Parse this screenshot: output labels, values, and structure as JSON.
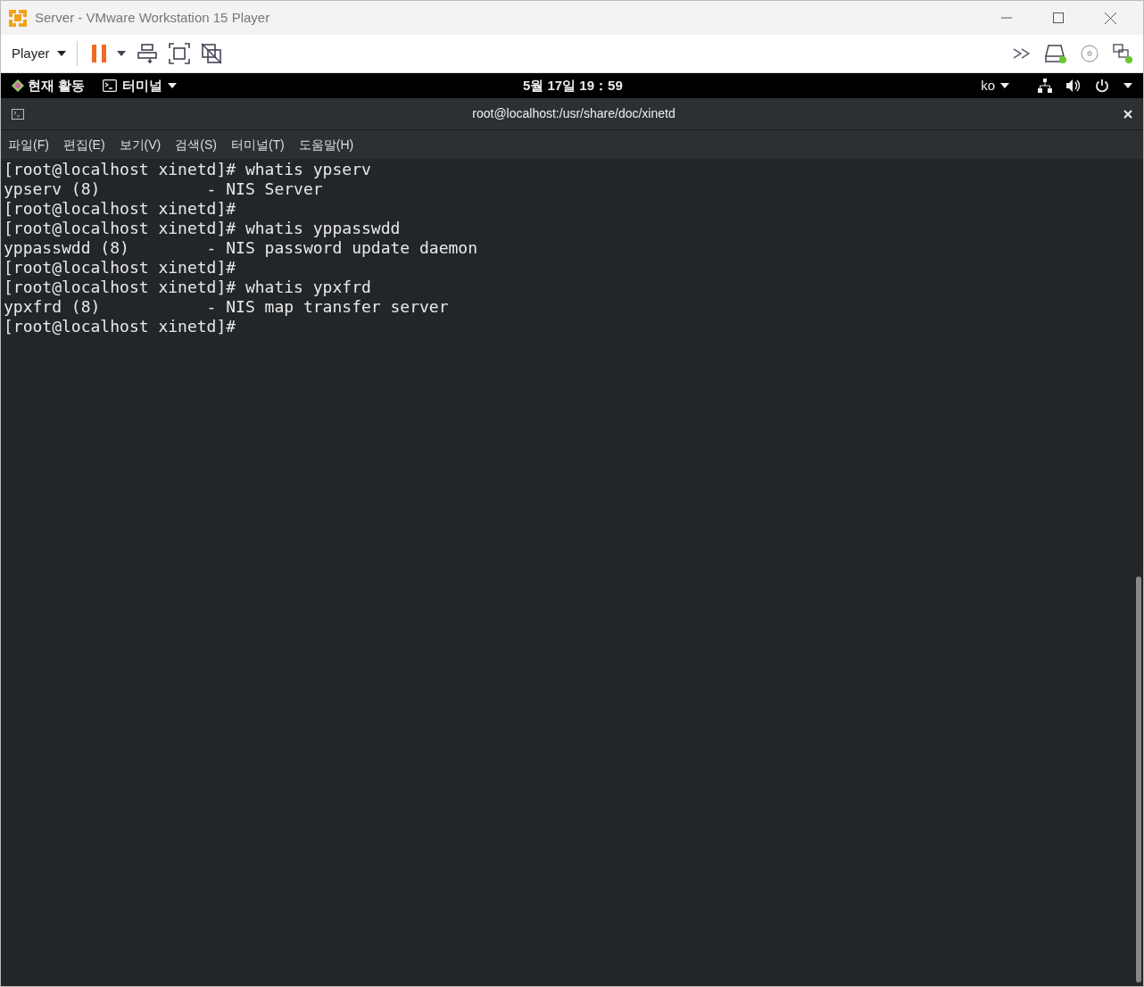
{
  "window": {
    "title": "Server - VMware Workstation 15 Player"
  },
  "toolbar": {
    "player_menu": "Player"
  },
  "top_bar": {
    "activities": "현재 활동",
    "app_menu": "터미널",
    "clock": "5월 17일  19：59",
    "input_method": "ko"
  },
  "terminal": {
    "title": "root@localhost:/usr/share/doc/xinetd",
    "menu": [
      "파일(F)",
      "편집(E)",
      "보기(V)",
      "검색(S)",
      "터미널(T)",
      "도움말(H)"
    ],
    "lines": [
      "[root@localhost xinetd]# whatis ypserv",
      "ypserv (8)           - NIS Server",
      "[root@localhost xinetd]#",
      "[root@localhost xinetd]# whatis yppasswdd",
      "yppasswdd (8)        - NIS password update daemon",
      "[root@localhost xinetd]#",
      "[root@localhost xinetd]# whatis ypxfrd",
      "ypxfrd (8)           - NIS map transfer server",
      "[root@localhost xinetd]#"
    ]
  }
}
